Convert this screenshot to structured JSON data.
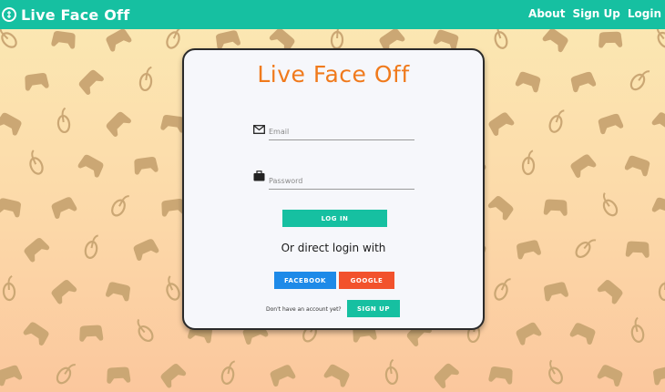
{
  "topbar": {
    "brand": "Live Face Off",
    "nav": [
      "About",
      "Sign Up",
      "Login"
    ]
  },
  "card": {
    "title": "Live Face Off",
    "email_placeholder": "Email",
    "password_placeholder": "Password",
    "login_label": "LOG IN",
    "direct_login_text": "Or direct login with",
    "facebook_label": "FACEBOOK",
    "google_label": "GOOGLE",
    "no_account_text": "Don't have an account yet?",
    "signup_label": "SIGN UP"
  },
  "colors": {
    "accent": "#16c0a1",
    "title": "#f07a1c",
    "facebook": "#1e8ae8",
    "google": "#f2522c",
    "pattern_icon": "#cba774"
  },
  "icons": [
    "app-logo-icon",
    "envelope-icon",
    "briefcase-icon",
    "gamepad-icon",
    "mouse-icon"
  ]
}
